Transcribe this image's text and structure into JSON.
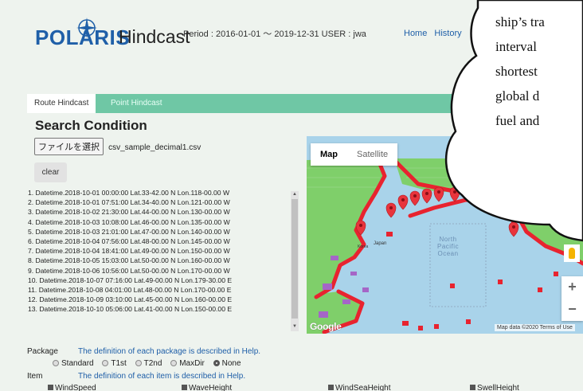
{
  "header": {
    "logo_polaris": "POLARIS",
    "logo_hindcast": "Hindcast",
    "period": "Period : 2016-01-01 ～ 2019-12-31  USER : jwa",
    "nav": [
      "Home",
      "History"
    ]
  },
  "tabs": [
    {
      "label": "Route Hindcast",
      "active": true
    },
    {
      "label": "Point Hindcast",
      "active": false
    }
  ],
  "search": {
    "title": "Search Condition",
    "file_button": "ファイルを選択",
    "file_name": "csv_sample_decimal1.csv",
    "clear_button": "clear"
  },
  "waypoints": [
    "1.  Datetime.2018-10-01 00:00:00  Lat.33-42.00 N  Lon.118-00.00 W",
    "2.  Datetime.2018-10-01 07:51:00  Lat.34-40.00 N  Lon.121-00.00 W",
    "3.  Datetime.2018-10-02 21:30:00  Lat.44-00.00 N  Lon.130-00.00 W",
    "4.  Datetime.2018-10-03 10:08:00  Lat.46-00.00 N  Lon.135-00.00 W",
    "5.  Datetime.2018-10-03 21:01:00  Lat.47-00.00 N  Lon.140-00.00 W",
    "6.  Datetime.2018-10-04 07:56:00  Lat.48-00.00 N  Lon.145-00.00 W",
    "7.  Datetime.2018-10-04 18:41:00  Lat.49-00.00 N  Lon.150-00.00 W",
    "8.  Datetime.2018-10-05 15:03:00  Lat.50-00.00 N  Lon.160-00.00 W",
    "9.  Datetime.2018-10-06 10:56:00  Lat.50-00.00 N  Lon.170-00.00 W",
    "10. Datetime.2018-10-07 07:16:00  Lat.49-00.00 N  Lon.179-30.00 E",
    "11. Datetime.2018-10-08 04:01:00  Lat.48-00.00 N  Lon.170-00.00 E",
    "12. Datetime.2018-10-09 03:10:00  Lat.45-00.00 N  Lon.160-00.00 E",
    "13. Datetime.2018-10-10 05:06:00  Lat.41-00.00 N  Lon.150-00.00 E"
  ],
  "map": {
    "type_map": "Map",
    "type_satellite": "Satellite",
    "ocean_line1": "North",
    "ocean_line2": "Pacific",
    "ocean_line3": "Ocean",
    "label_japan": "Japan",
    "label_korea": "Korea",
    "google": "Google",
    "map_data": "Map data ©2020   Terms of Use",
    "zoom_in": "+",
    "zoom_out": "−",
    "colors": {
      "ocean": "#a9d3ea",
      "land": "#7fcf6a",
      "track": "#e8232f",
      "marker": "#e8343c"
    }
  },
  "package": {
    "label": "Package",
    "help": "The definition of each package is described in Help.",
    "options": [
      "Standard",
      "T1st",
      "T2nd",
      "MaxDir",
      "None"
    ],
    "selected": "None"
  },
  "item": {
    "label": "Item",
    "help": "The definition of each item is described in Help.",
    "checks": [
      "WindSpeed",
      "WaveHeight",
      "WindSeaHeight",
      "SwellHeight"
    ]
  },
  "bubble": {
    "lines": [
      "ship’s tra",
      "interval",
      "shortest",
      "global d",
      "fuel and"
    ]
  }
}
